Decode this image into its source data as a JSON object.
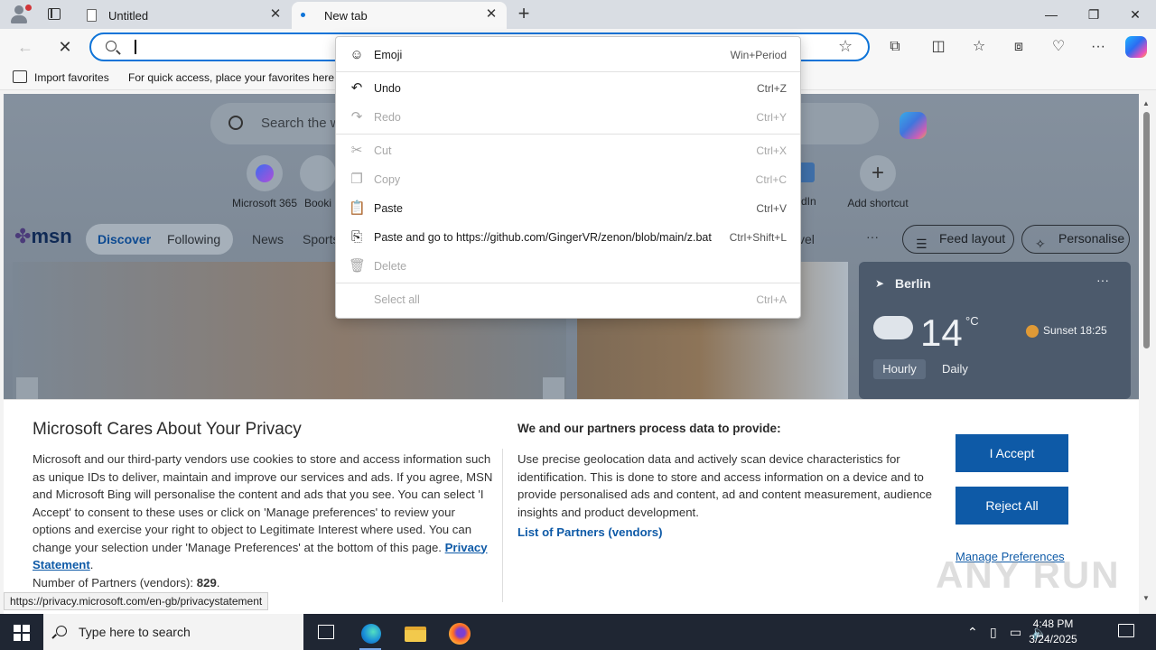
{
  "browser": {
    "tabs": [
      {
        "label": "Untitled",
        "active": false
      },
      {
        "label": "New tab",
        "active": true
      }
    ],
    "address_value": "",
    "favorites_bar": {
      "import_label": "Import favorites",
      "hint": "For quick access, place your favorites here c"
    },
    "colors": {
      "accent": "#0e74d8"
    }
  },
  "newtab": {
    "search_placeholder": "Search the w",
    "shortcuts": [
      {
        "label": "Microsoft 365"
      },
      {
        "label": "Booki"
      },
      {
        "label": "edIn"
      },
      {
        "label": "Add shortcut"
      }
    ],
    "msn": {
      "logo": "msn",
      "tabs": [
        "Discover",
        "Following"
      ],
      "links": [
        "News",
        "Sports",
        "vel"
      ],
      "more": "···",
      "feed_layout": "Feed layout",
      "personalise": "Personalise"
    },
    "weather": {
      "city": "Berlin",
      "temp": "14",
      "unit": "°C",
      "sunset": "Sunset 18:25",
      "hourly": "Hourly",
      "daily": "Daily"
    }
  },
  "context_menu": {
    "items": [
      {
        "label": "Emoji",
        "shortcut": "Win+Period",
        "enabled": true,
        "icon": "emoji-icon"
      },
      {
        "label": "Undo",
        "shortcut": "Ctrl+Z",
        "enabled": true,
        "icon": "undo-icon"
      },
      {
        "label": "Redo",
        "shortcut": "Ctrl+Y",
        "enabled": false,
        "icon": "redo-icon"
      },
      {
        "label": "Cut",
        "shortcut": "Ctrl+X",
        "enabled": false,
        "icon": "cut-icon"
      },
      {
        "label": "Copy",
        "shortcut": "Ctrl+C",
        "enabled": false,
        "icon": "copy-icon"
      },
      {
        "label": "Paste",
        "shortcut": "Ctrl+V",
        "enabled": true,
        "icon": "paste-icon"
      },
      {
        "label": "Paste and go to https://github.com/GingerVR/zenon/blob/main/z.bat",
        "shortcut": "Ctrl+Shift+L",
        "enabled": true,
        "icon": "paste-go-icon"
      },
      {
        "label": "Delete",
        "shortcut": "",
        "enabled": false,
        "icon": "delete-icon"
      },
      {
        "label": "Select all",
        "shortcut": "Ctrl+A",
        "enabled": false,
        "icon": ""
      }
    ]
  },
  "privacy": {
    "title": "Microsoft Cares About Your Privacy",
    "body_pre": "Microsoft and our third-party vendors use cookies to store and access information such as unique IDs to deliver, maintain and improve our services and ads. If you agree, MSN and Microsoft Bing will personalise the content and ads that you see. You can select 'I Accept' to consent to these uses or click on 'Manage preferences' to review your options and exercise your right to object to Legitimate Interest where used. You can change your selection under 'Manage Preferences' at the bottom of this page.",
    "privacy_link": "Privacy Statement",
    "partners_label": "Number of Partners (vendors):",
    "partners_count": "829",
    "right_heading": "We and our partners process data to provide:",
    "right_body": "Use precise geolocation data and actively scan device characteristics for identification. This is done to store and access information on a device and to provide personalised ads and content, ad and content measurement, audience insights and product development.",
    "partners_link": "List of Partners (vendors)",
    "accept": "I Accept",
    "reject": "Reject All",
    "manage": "Manage Preferences",
    "watermark": "ANY RUN"
  },
  "status_url": "https://privacy.microsoft.com/en-gb/privacystatement",
  "taskbar": {
    "search_placeholder": "Type here to search",
    "time": "4:48 PM",
    "date": "3/24/2025"
  }
}
